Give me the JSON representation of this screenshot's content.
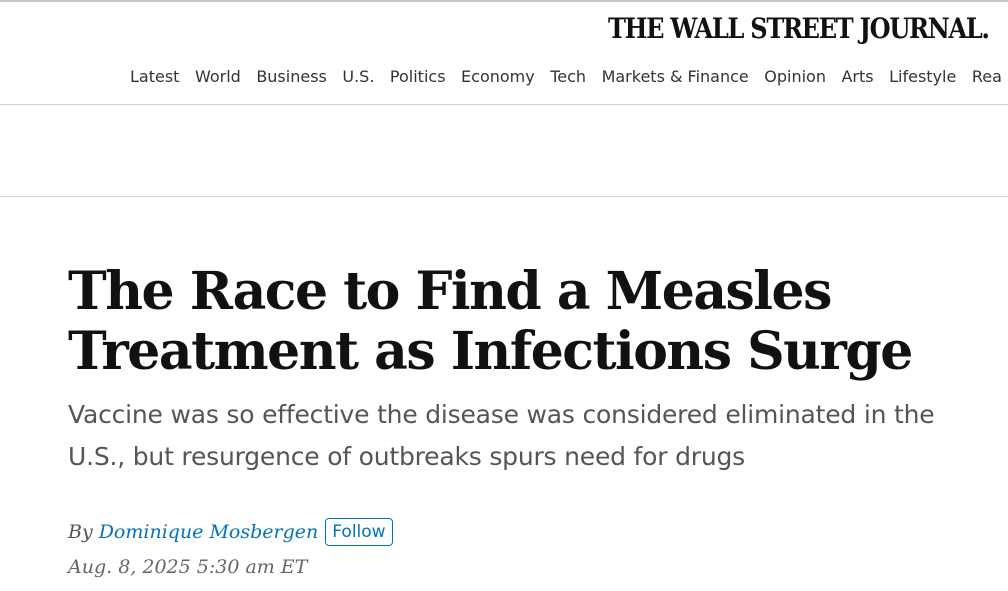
{
  "masthead": {
    "logo_text": "THE WALL STREET JOURNAL."
  },
  "nav": {
    "items": [
      {
        "label": "Latest"
      },
      {
        "label": "World"
      },
      {
        "label": "Business"
      },
      {
        "label": "U.S."
      },
      {
        "label": "Politics"
      },
      {
        "label": "Economy"
      },
      {
        "label": "Tech"
      },
      {
        "label": "Markets & Finance"
      },
      {
        "label": "Opinion"
      },
      {
        "label": "Arts"
      },
      {
        "label": "Lifestyle"
      },
      {
        "label": "Rea"
      }
    ]
  },
  "article": {
    "headline": "The Race to Find a Measles Treatment as Infections Surge",
    "dek": "Vaccine was so effective the disease was considered eliminated in the U.S., but resurgence of outbreaks spurs need for drugs",
    "byline_prefix": "By",
    "author": "Dominique Mosbergen",
    "follow_label": "Follow",
    "timestamp": "Aug. 8, 2025 5:30 am ET"
  },
  "colors": {
    "link_blue": "#0274b6",
    "dek_gray": "#555555",
    "rule_gray": "#d0d0d0"
  }
}
